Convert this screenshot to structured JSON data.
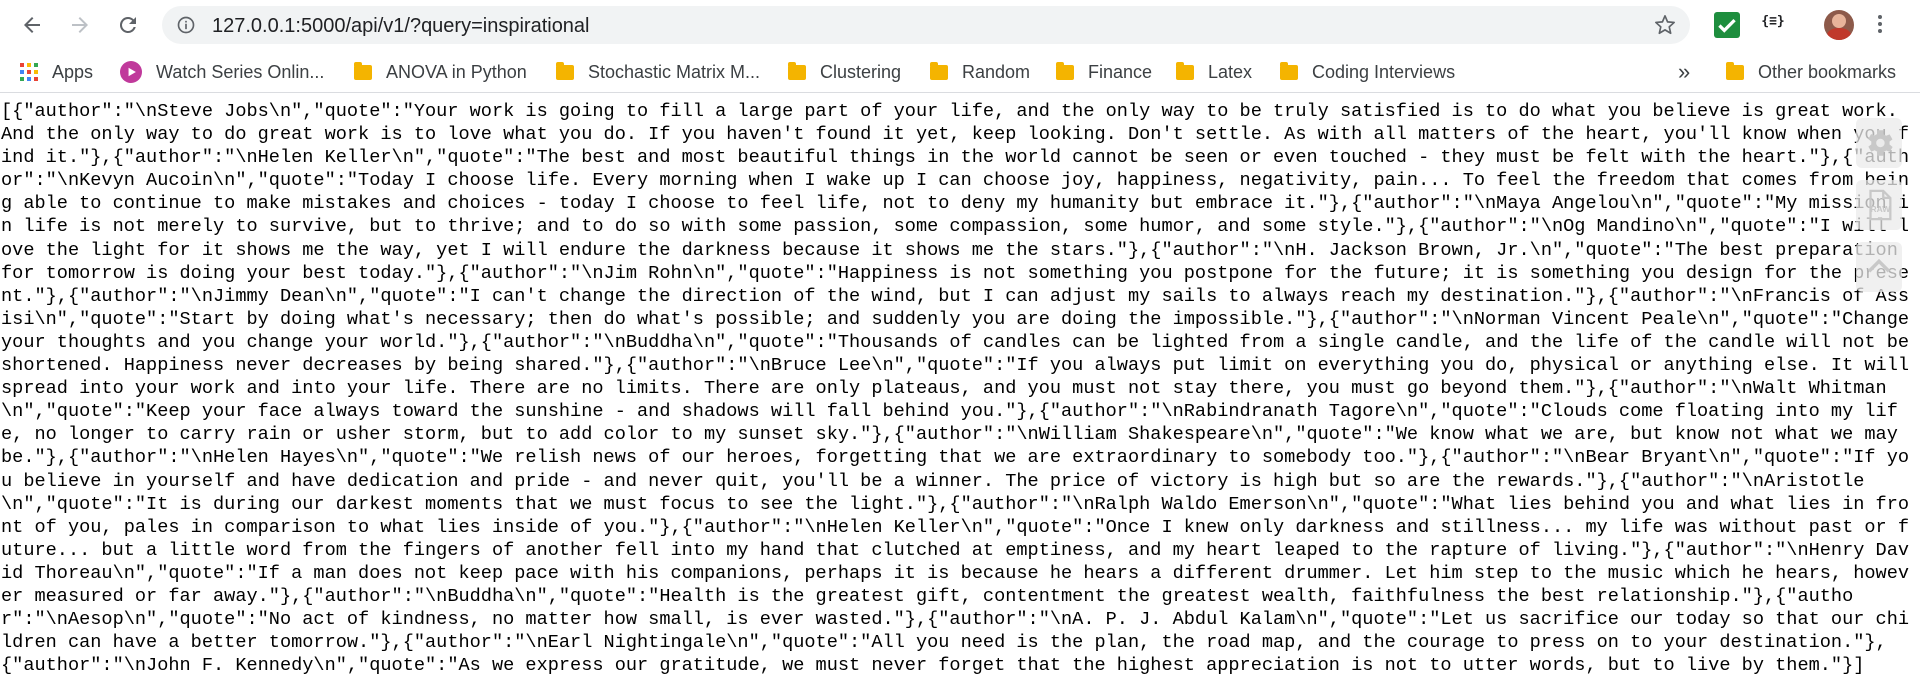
{
  "browser": {
    "url": "127.0.0.1:5000/api/v1/?query=inspirational",
    "icons": [
      "back-icon",
      "forward-icon",
      "reload-icon",
      "info-icon",
      "star-icon",
      "checkmark-extension-icon",
      "json-viewer-extension-icon",
      "profile-avatar",
      "menu-icon"
    ]
  },
  "bookmarks": {
    "apps_label": "Apps",
    "items": [
      {
        "label": "Watch Series Onlin..."
      },
      {
        "label": "ANOVA in Python"
      },
      {
        "label": "Stochastic Matrix M..."
      },
      {
        "label": "Clustering"
      },
      {
        "label": "Random"
      },
      {
        "label": "Finance"
      },
      {
        "label": "Latex"
      },
      {
        "label": "Coding Interviews"
      }
    ],
    "overflow_label": "»",
    "other_label": "Other bookmarks"
  },
  "response_text": "[{\"author\":\"\\nSteve Jobs\\n\",\"quote\":\"Your work is going to fill a large part of your life, and the only way to be truly satisfied is to do what you believe is great work. And the only way to do great work is to love what you do. If you haven't found it yet, keep looking. Don't settle. As with all matters of the heart, you'll know when you find it.\"},{\"author\":\"\\nHelen Keller\\n\",\"quote\":\"The best and most beautiful things in the world cannot be seen or even touched - they must be felt with the heart.\"},{\"author\":\"\\nKevyn Aucoin\\n\",\"quote\":\"Today I choose life. Every morning when I wake up I can choose joy, happiness, negativity, pain... To feel the freedom that comes from being able to continue to make mistakes and choices - today I choose to feel life, not to deny my humanity but embrace it.\"},{\"author\":\"\\nMaya Angelou\\n\",\"quote\":\"My mission in life is not merely to survive, but to thrive; and to do so with some passion, some compassion, some humor, and some style.\"},{\"author\":\"\\nOg Mandino\\n\",\"quote\":\"I will love the light for it shows me the way, yet I will endure the darkness because it shows me the stars.\"},{\"author\":\"\\nH. Jackson Brown, Jr.\\n\",\"quote\":\"The best preparation for tomorrow is doing your best today.\"},{\"author\":\"\\nJim Rohn\\n\",\"quote\":\"Happiness is not something you postpone for the future; it is something you design for the present.\"},{\"author\":\"\\nJimmy Dean\\n\",\"quote\":\"I can't change the direction of the wind, but I can adjust my sails to always reach my destination.\"},{\"author\":\"\\nFrancis of Assisi\\n\",\"quote\":\"Start by doing what's necessary; then do what's possible; and suddenly you are doing the impossible.\"},{\"author\":\"\\nNorman Vincent Peale\\n\",\"quote\":\"Change your thoughts and you change your world.\"},{\"author\":\"\\nBuddha\\n\",\"quote\":\"Thousands of candles can be lighted from a single candle, and the life of the candle will not be shortened. Happiness never decreases by being shared.\"},{\"author\":\"\\nBruce Lee\\n\",\"quote\":\"If you always put limit on everything you do, physical or anything else. It will spread into your work and into your life. There are no limits. There are only plateaus, and you must not stay there, you must go beyond them.\"},{\"author\":\"\\nWalt Whitman\\n\",\"quote\":\"Keep your face always toward the sunshine - and shadows will fall behind you.\"},{\"author\":\"\\nRabindranath Tagore\\n\",\"quote\":\"Clouds come floating into my life, no longer to carry rain or usher storm, but to add color to my sunset sky.\"},{\"author\":\"\\nWilliam Shakespeare\\n\",\"quote\":\"We know what we are, but know not what we may be.\"},{\"author\":\"\\nHelen Hayes\\n\",\"quote\":\"We relish news of our heroes, forgetting that we are extraordinary to somebody too.\"},{\"author\":\"\\nBear Bryant\\n\",\"quote\":\"If you believe in yourself and have dedication and pride - and never quit, you'll be a winner. The price of victory is high but so are the rewards.\"},{\"author\":\"\\nAristotle\\n\",\"quote\":\"It is during our darkest moments that we must focus to see the light.\"},{\"author\":\"\\nRalph Waldo Emerson\\n\",\"quote\":\"What lies behind you and what lies in front of you, pales in comparison to what lies inside of you.\"},{\"author\":\"\\nHelen Keller\\n\",\"quote\":\"Once I knew only darkness and stillness... my life was without past or future... but a little word from the fingers of another fell into my hand that clutched at emptiness, and my heart leaped to the rapture of living.\"},{\"author\":\"\\nHenry David Thoreau\\n\",\"quote\":\"If a man does not keep pace with his companions, perhaps it is because he hears a different drummer. Let him step to the music which he hears, however measured or far away.\"},{\"author\":\"\\nBuddha\\n\",\"quote\":\"Health is the greatest gift, contentment the greatest wealth, faithfulness the best relationship.\"},{\"author\":\"\\nAesop\\n\",\"quote\":\"No act of kindness, no matter how small, is ever wasted.\"},{\"author\":\"\\nA. P. J. Abdul Kalam\\n\",\"quote\":\"Let us sacrifice our today so that our children can have a better tomorrow.\"},{\"author\":\"\\nEarl Nightingale\\n\",\"quote\":\"All you need is the plan, the road map, and the courage to press on to your destination.\"},{\"author\":\"\\nJohn F. Kennedy\\n\",\"quote\":\"As we express our gratitude, we must never forget that the highest appreciation is not to utter words, but to live by them.\"}]",
  "side_panel": {
    "raw_label": "RAW",
    "icons": [
      "gear-icon",
      "raw-file-icon",
      "chevron-up-icon"
    ]
  }
}
